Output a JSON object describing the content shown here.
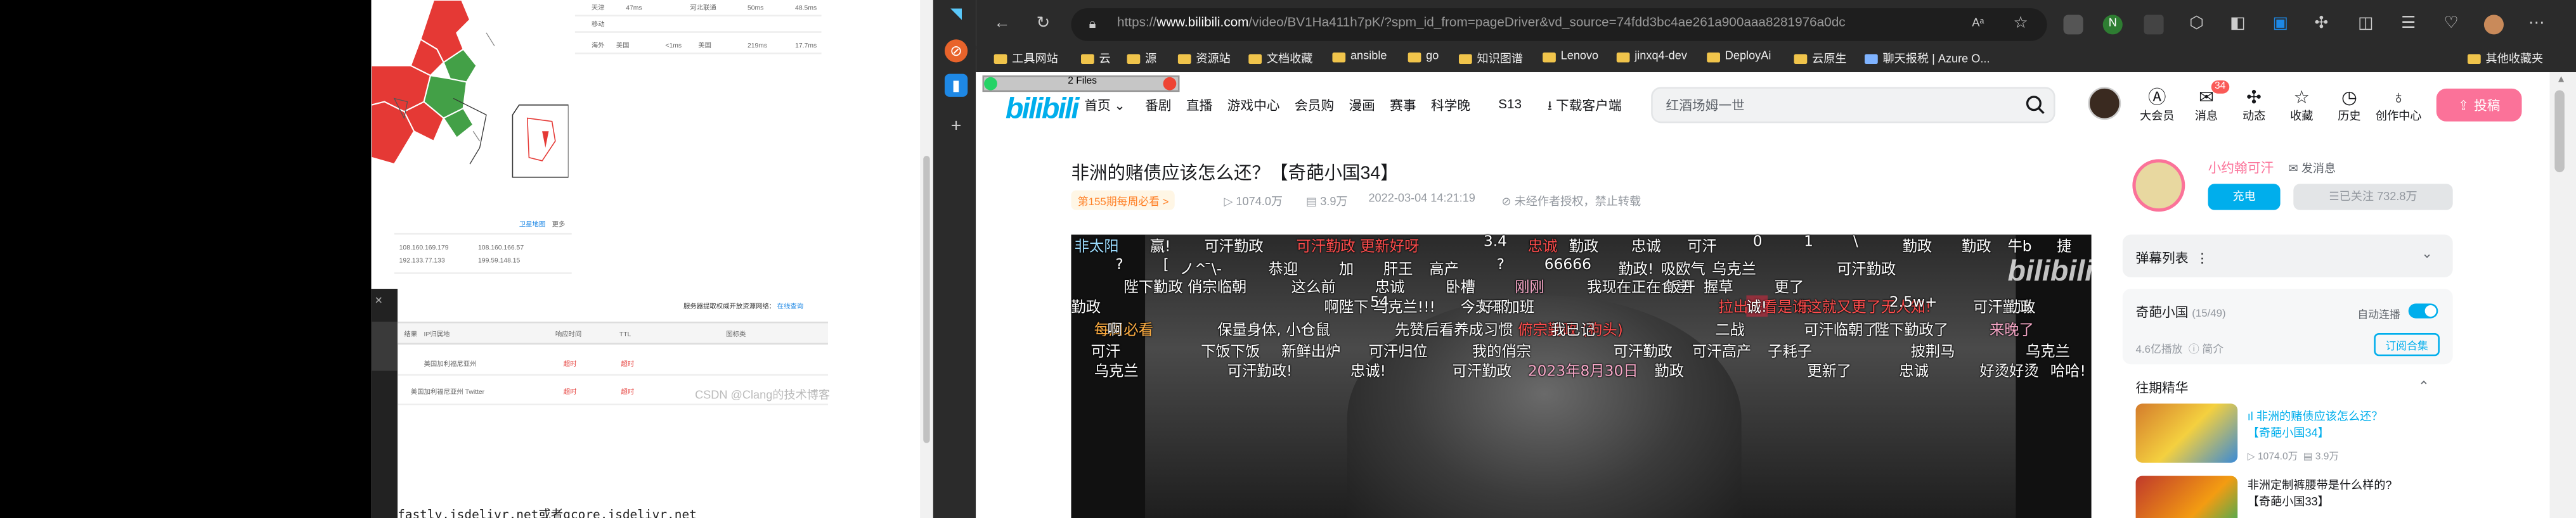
{
  "left_window": {
    "table_rows": [
      {
        "c1": "天津",
        "c2": "47ms",
        "c3": "河北联通",
        "c4": "50ms",
        "c5": "48.5ms"
      },
      {
        "c1": "移动",
        "c2": "",
        "c3": "",
        "c4": "",
        "c5": ""
      },
      {
        "c1": "海外",
        "c2": "美国",
        "c3": "<1ms",
        "c4": "美国",
        "c5": "219ms",
        "c6": "17.7ms"
      }
    ],
    "map_links": [
      "卫星地图",
      "更多"
    ],
    "ip_rows": [
      [
        "108.160.169.179",
        "108.160.166.57"
      ],
      [
        "192.133.77.133",
        "199.59.148.15"
      ]
    ],
    "ranking_label": "服务器提取权威开放资源网络：",
    "ranking_link": "在线查询",
    "result_headers": [
      "结果",
      "IP归属地",
      "响应时间",
      "TTL",
      "图标类"
    ],
    "result_rows": [
      {
        "loc": "美国加利福尼亚州",
        "time": "超时",
        "ttl": "超时"
      },
      {
        "loc": "美国加利福尼亚州 Twitter",
        "time": "超时",
        "ttl": "超时"
      }
    ],
    "watermark": "CSDN @Clang的技术博客",
    "code_text": "fastly.jsdelivr.net或者gcore.jsdelivr.net"
  },
  "browser": {
    "url_prefix": "https://",
    "url_domain": "www.bilibili.com",
    "url_path": "/video/BV1Ha411h7pK/?spm_id_from=pageDriver&vd_source=74fdd3bc4ae261a900aaa8281976a0dc",
    "bookmarks": [
      "工具网站",
      "云",
      "源",
      "资源站",
      "文档收藏",
      "ansible",
      "go",
      "知识图谱",
      "Lenovo",
      "jinxq4-dev",
      "DeployAi",
      "云原生",
      "聊天报税 | Azure O...",
      "其他收藏夹"
    ],
    "whatsapp_label": "2 Files"
  },
  "bili": {
    "logo": "bilibili",
    "nav": [
      "首页",
      "番剧",
      "直播",
      "游戏中心",
      "会员购",
      "漫画",
      "赛事",
      "科学晚",
      "S13",
      "下载客户端"
    ],
    "search_placeholder": "红酒场姆一世",
    "header_icons": [
      "大会员",
      "消息",
      "动态",
      "收藏",
      "历史",
      "创作中心"
    ],
    "msg_badge": "34",
    "upload": "投稿",
    "video_title": "非洲的赌债应该怎么还？【奇葩小国34】",
    "weekly_tag": "第155期每周必看 >",
    "views": "1074.0万",
    "danmaku_count": "3.9万",
    "date": "2022-03-04 14:21:19",
    "copyright": "未经作者授权，禁止转载",
    "up_name": "小约翰可汗",
    "send_msg": "发消息",
    "charge": "充电",
    "followed": "已关注 732.8万",
    "danmaku_list": "弹幕列表",
    "collection_title": "奇葩小国",
    "collection_progress": "(15/49)",
    "autoplay": "自动连播",
    "collection_plays": "4.6亿播放",
    "collection_intro": "简介",
    "subscribe": "订阅合集",
    "past_picks": "往期精华",
    "episodes": [
      {
        "title1": "非洲的赌债应该怎么还？",
        "title2": "【奇葩小国34】",
        "views": "1074.0万",
        "danmaku": "3.9万"
      },
      {
        "title1": "非洲定制裤腰带是什么样的?",
        "title2": "【奇葩小国33】",
        "views": "",
        "danmaku": ""
      }
    ],
    "danmaku": [
      "非太阳",
      "赢!",
      "可汗勤政",
      "可汗勤政 更新好呀",
      "3.4",
      "忠诚",
      "勤政",
      "忠诚",
      "可汗",
      "0",
      "1",
      "\\",
      "勤政",
      "勤政",
      "牛b",
      "捷",
      "?",
      "[",
      "ノ^ ̄\\-",
      "恭迎",
      "加",
      "肝王",
      "高产",
      "?",
      "66666",
      "勤政!",
      "吸欧气",
      "乌克兰",
      "可汗勤政",
      "陛下勤政 俏宗临朝",
      "这么前",
      "忠诚",
      "卧槽",
      "刚刚",
      "我现在正在食堂",
      "饭开",
      "握草",
      "更了",
      "勤政",
      "啊陛下 乌克兰!!!",
      "54.",
      "今天不加班",
      "好耶",
      "拉出来看是谁这就又更了无人知!",
      "诚!",
      "乐",
      "2.5w+",
      "可汗勤政",
      "勤政",
      "每周必看",
      "啊",
      "保量身体, 小仓鼠",
      "先赞后看养成习惯",
      "俯宗勤政 (狗头)",
      "我已记",
      "二战",
      "可汗临朝了",
      "陛下勤政了",
      "来晚了",
      "可汗",
      "下饭下饭",
      "新鲜出炉",
      "可汗归位",
      "我的俏宗",
      "可汗勤政",
      "可汗高产",
      "子耗子",
      "披荆马",
      "乌克兰",
      "乌克兰",
      "可汗勤政!",
      "忠诚!",
      "可汗勤政",
      "2023年8月30日",
      "勤政",
      "更新了",
      "忠诚",
      "好烫好烫",
      "哈哈!",
      "可汗"
    ]
  },
  "colors": {
    "bili_blue": "#00aeec",
    "bili_pink": "#fb7299",
    "browser_dark": "#2b2b2b"
  }
}
